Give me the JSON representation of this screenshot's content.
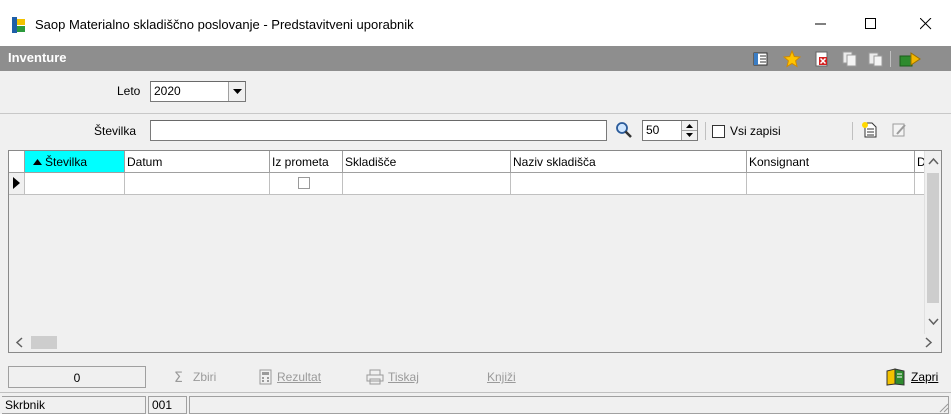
{
  "window": {
    "title": "Saop Materialno skladiščno poslovanje - Predstavitveni uporabnik"
  },
  "header": {
    "title": "Inventure"
  },
  "filters": {
    "year_label": "Leto",
    "year_value": "2020",
    "number_label": "Številka",
    "number_value": "",
    "page_size": "50",
    "all_records_label": "Vsi zapisi"
  },
  "grid": {
    "columns": [
      "Številka",
      "Datum",
      "Iz prometa",
      "Skladišče",
      "Naziv skladišča",
      "Konsignant",
      "Dol"
    ],
    "sorted_column": "Številka",
    "rows": [
      {
        "stevilka": "",
        "datum": "",
        "iz_prometa": false,
        "skladisce": "",
        "naziv": "",
        "konsignant": "",
        "dol": ""
      }
    ]
  },
  "footer": {
    "count": "0",
    "sum_label": "Zbiri",
    "result_label": "Rezultat",
    "print_label": "Tiskaj",
    "post_label": "Knjiži",
    "close_label": "Zapri"
  },
  "statusbar": {
    "user": "Skrbnik",
    "code": "001",
    "message": ""
  },
  "colors": {
    "header_band": "#8e8e8e",
    "sorted_header": "#00ffff",
    "window_bg": "#f0f0f0"
  }
}
